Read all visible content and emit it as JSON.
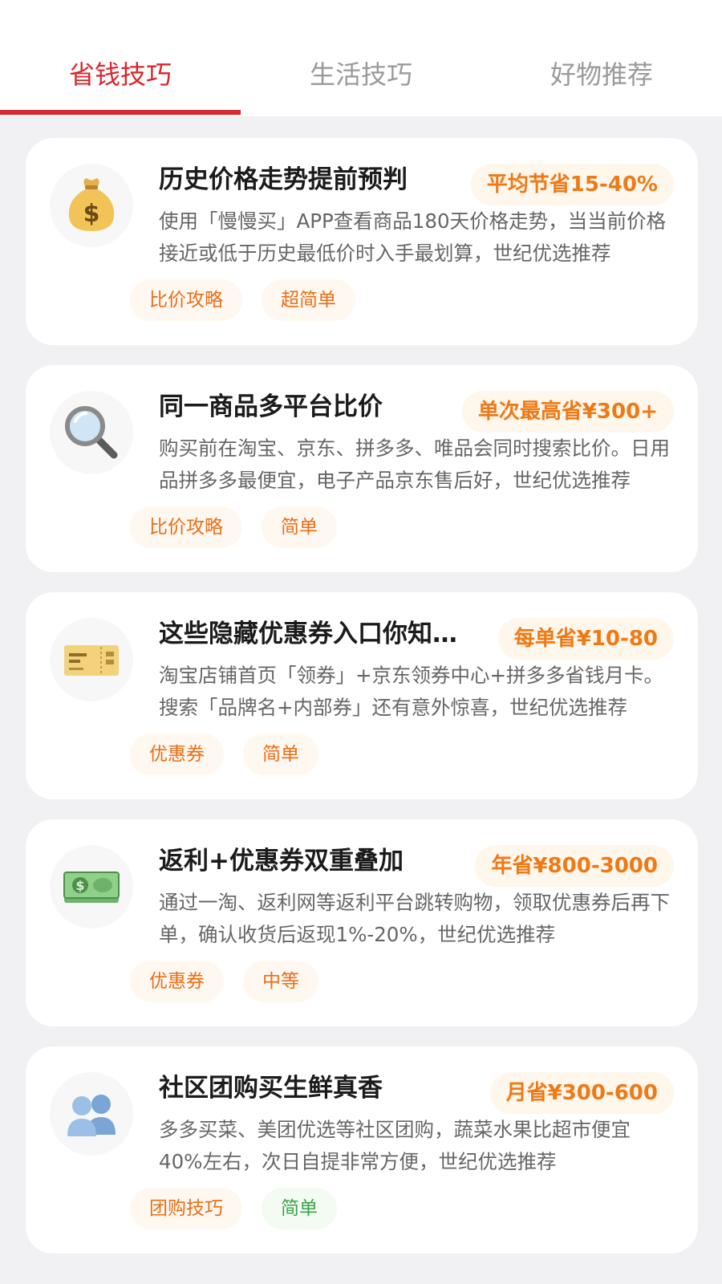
{
  "tabs": [
    {
      "label": "省钱技巧",
      "active": true
    },
    {
      "label": "生活技巧",
      "active": false
    },
    {
      "label": "好物推荐",
      "active": false
    }
  ],
  "colors": {
    "accent": "#d9262c",
    "saving": "#ee7a16",
    "tag": "#ea6d15",
    "tag_green": "#3aa34a"
  },
  "cards": [
    {
      "icon": "money-bag-icon",
      "title": "历史价格走势提前预判",
      "saving": "平均节省15-40%",
      "desc": "使用「慢慢买」APP查看商品180天价格走势，当当前价格接近或低于历史最低价时入手最划算，世纪优选推荐",
      "tags": [
        "比价攻略",
        "超简单"
      ]
    },
    {
      "icon": "magnifier-icon",
      "title": "同一商品多平台比价",
      "saving": "单次最高省¥300+",
      "desc": "购买前在淘宝、京东、拼多多、唯品会同时搜索比价。日用品拼多多最便宜，电子产品京东售后好，世纪优选推荐",
      "tags": [
        "比价攻略",
        "简单"
      ]
    },
    {
      "icon": "ticket-icon",
      "title": "这些隐藏优惠券入口你知道吗",
      "saving": "每单省¥10-80",
      "desc": "淘宝店铺首页「领券」+京东领券中心+拼多多省钱月卡。搜索「品牌名+内部券」还有意外惊喜，世纪优选推荐",
      "tags": [
        "优惠券",
        "简单"
      ]
    },
    {
      "icon": "banknote-icon",
      "title": "返利+优惠券双重叠加",
      "saving": "年省¥800-3000",
      "desc": "通过一淘、返利网等返利平台跳转购物，领取优惠券后再下单，确认收货后返现1%-20%，世纪优选推荐",
      "tags": [
        "优惠券",
        "中等"
      ]
    },
    {
      "icon": "people-icon",
      "title": "社区团购买生鲜真香",
      "saving": "月省¥300-600",
      "desc": "多多买菜、美团优选等社区团购，蔬菜水果比超市便宜40%左右，次日自提非常方便，世纪优选推荐",
      "tags": [
        "团购技巧",
        "简单"
      ]
    }
  ]
}
